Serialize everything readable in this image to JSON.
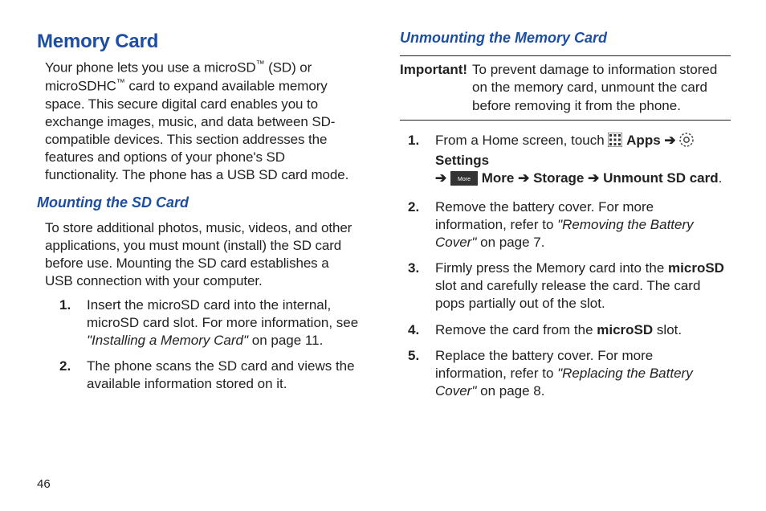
{
  "pageNumber": "46",
  "left": {
    "heading": "Memory Card",
    "para1_pre": "Your phone lets you use a microSD",
    "para1_tm1": "™",
    "para1_mid": " (SD) or microSDHC",
    "para1_tm2": "™",
    "para1_post": " card to expand available memory space. This secure digital card enables you to exchange images, music, and data between SD-compatible devices. This section addresses the features and options of your phone's SD functionality. The phone has a USB SD card mode.",
    "sub1": "Mounting the SD Card",
    "sub1_para": "To store additional photos, music, videos, and other applications, you must mount (install) the SD card before use. Mounting the SD card establishes a USB connection with your computer.",
    "step1_num": "1.",
    "step1_a": "Insert the microSD card into the internal, microSD card slot. For more information, see ",
    "step1_ref": "\"Installing a Memory Card\"",
    "step1_b": " on page 11.",
    "step2_num": "2.",
    "step2": "The phone scans the SD card and views the available information stored on it."
  },
  "right": {
    "sub": "Unmounting the Memory Card",
    "important_label": "Important!",
    "important_text": "To prevent damage to information stored on the memory card, unmount the card before removing it from the phone.",
    "s1_num": "1.",
    "s1_a": "From a Home screen, touch ",
    "s1_apps": "Apps",
    "s1_settings": "Settings",
    "s1_more": "More",
    "s1_storage": "Storage",
    "s1_unmount": "Unmount SD card",
    "arrow": "➔",
    "period": ".",
    "s2_num": "2.",
    "s2_a": "Remove the battery cover. For more information, refer to ",
    "s2_ref": "\"Removing the Battery Cover\"",
    "s2_b": " on page 7.",
    "s3_num": "3.",
    "s3_a": "Firmly press the Memory card into the ",
    "s3_b": "microSD",
    "s3_c": " slot and carefully release the card. The card pops partially out of the slot.",
    "s4_num": "4.",
    "s4_a": "Remove the card from the ",
    "s4_b": "microSD",
    "s4_c": " slot.",
    "s5_num": "5.",
    "s5_a": "Replace the battery cover. For more information, refer to ",
    "s5_ref": "\"Replacing the Battery Cover\"",
    "s5_b": " on page 8."
  }
}
